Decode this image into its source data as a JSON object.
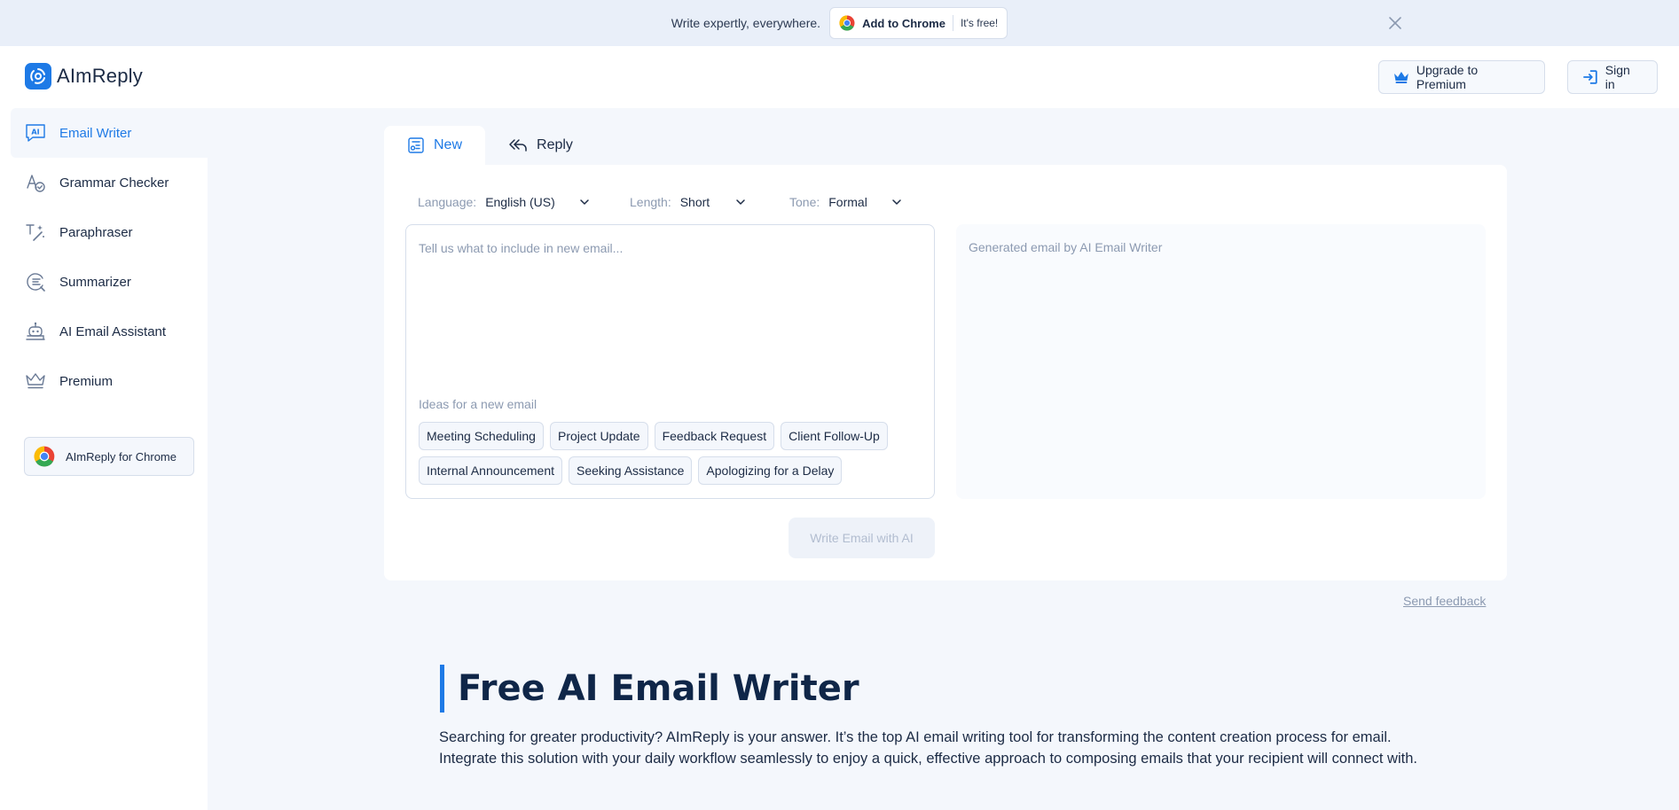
{
  "banner": {
    "text": "Write expertly, everywhere.",
    "cta_label": "Add to Chrome",
    "cta_note": "It's free!"
  },
  "header": {
    "logo_text": "AImReply",
    "upgrade_label": "Upgrade to Premium",
    "signin_label": "Sign in"
  },
  "sidebar": {
    "items": [
      {
        "label": "Email Writer",
        "icon": "ai-chat-icon"
      },
      {
        "label": "Grammar Checker",
        "icon": "grammar-icon"
      },
      {
        "label": "Paraphraser",
        "icon": "paraphrase-icon"
      },
      {
        "label": "Summarizer",
        "icon": "summarize-icon"
      },
      {
        "label": "AI Email Assistant",
        "icon": "robot-icon"
      },
      {
        "label": "Premium",
        "icon": "crown-icon"
      }
    ],
    "chrome_label": "AImReply for Chrome"
  },
  "tool": {
    "tabs": [
      {
        "label": "New"
      },
      {
        "label": "Reply"
      }
    ],
    "options": {
      "language_label": "Language:",
      "language_value": "English (US)",
      "length_label": "Length:",
      "length_value": "Short",
      "tone_label": "Tone:",
      "tone_value": "Formal"
    },
    "input_placeholder": "Tell us what to include in new email...",
    "ideas_label": "Ideas for a new email",
    "ideas": [
      "Meeting Scheduling",
      "Project Update",
      "Feedback Request",
      "Client Follow-Up",
      "Internal Announcement",
      "Seeking Assistance",
      "Apologizing for a Delay"
    ],
    "output_placeholder": "Generated email by AI Email Writer",
    "write_label": "Write Email with AI"
  },
  "feedback_label": "Send feedback",
  "article": {
    "title": "Free AI Email Writer",
    "body": "Searching for greater productivity? AImReply is your answer. It’s the top AI email writing tool for transforming the content creation process for email. Integrate this solution with your daily workflow seamlessly to enjoy a quick, effective approach to composing emails that your recipient will connect with."
  },
  "colors": {
    "accent": "#1e7ae6",
    "page_bg": "#f4f7fc",
    "border": "#d6deeb",
    "muted_text": "#8c9ab1",
    "title_text": "#0f2648"
  }
}
